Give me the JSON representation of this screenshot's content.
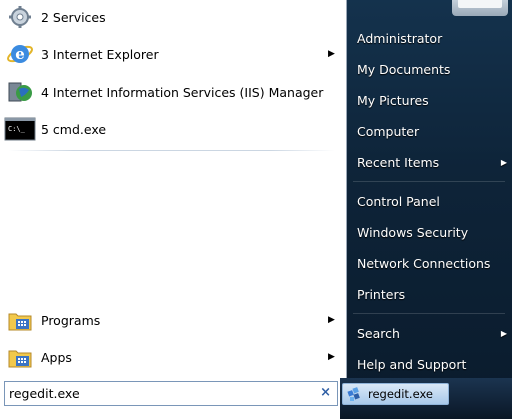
{
  "programs": [
    {
      "label": "2 Services",
      "icon": "services-icon",
      "arrow": false
    },
    {
      "label": "3 Internet Explorer",
      "icon": "internet-explorer-icon",
      "arrow": true
    },
    {
      "label": "4 Internet Information Services (IIS) Manager",
      "icon": "iis-manager-icon",
      "arrow": false
    },
    {
      "label": "5 cmd.exe",
      "icon": "cmd-icon",
      "arrow": false
    }
  ],
  "folders": [
    {
      "label": "Programs",
      "icon": "programs-folder-icon",
      "arrow": true
    },
    {
      "label": "Apps",
      "icon": "apps-folder-icon",
      "arrow": true
    }
  ],
  "search": {
    "value": "regedit.exe",
    "clear_glyph": "×"
  },
  "right_items": [
    {
      "label": "Administrator",
      "arrow": false
    },
    {
      "label": "My Documents",
      "arrow": false
    },
    {
      "label": "My Pictures",
      "arrow": false
    },
    {
      "label": "Computer",
      "arrow": false
    },
    {
      "label": "Recent Items",
      "arrow": true
    },
    {
      "label": "Control Panel",
      "arrow": false
    },
    {
      "label": "Windows Security",
      "arrow": false
    },
    {
      "label": "Network Connections",
      "arrow": false
    },
    {
      "label": "Printers",
      "arrow": false
    },
    {
      "label": "Search",
      "arrow": true
    },
    {
      "label": "Help and Support",
      "arrow": false
    }
  ],
  "taskbar_button": {
    "label": "regedit.exe",
    "icon": "regedit-icon"
  },
  "colors": {
    "left_bg": "#ffffff",
    "right_bg": "#0e2439",
    "accent": "#2f5fa5"
  }
}
